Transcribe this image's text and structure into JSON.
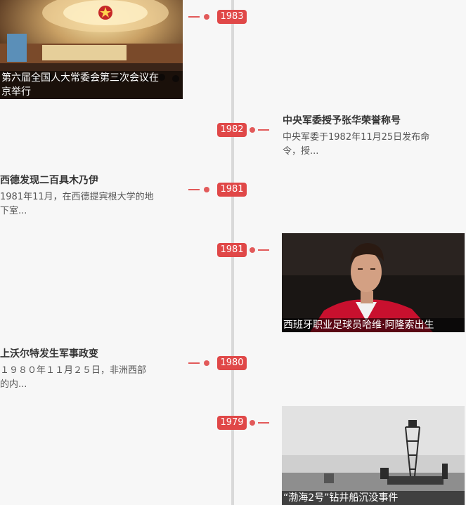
{
  "timeline": {
    "events": [
      {
        "year": "1983",
        "title": "第六届全国人大常委会第三次会议在京举行",
        "title_display": "第六届全国人大常委会第三次会议在\n京举行"
      },
      {
        "year": "1982",
        "title": "中央军委授予张华荣誉称号",
        "desc": "中央军委于1982年11月25日发布命\n令，授..."
      },
      {
        "year": "1981",
        "title": "西德发现二百具木乃伊",
        "desc": "1981年11月，在西德提宾根大学的地\n下室..."
      },
      {
        "year": "1981",
        "title": "西班牙职业足球员哈维·阿隆索出生"
      },
      {
        "year": "1980",
        "title": "上沃尔特发生军事政变",
        "desc": "１９８０年１１月２５日，非洲西部\n的内..."
      },
      {
        "year": "1979",
        "title": "“渤海2号”钻井船沉没事件"
      }
    ]
  },
  "colors": {
    "accent": "#e04848",
    "axis": "#d9d9d9",
    "background": "#f7f7f7"
  }
}
